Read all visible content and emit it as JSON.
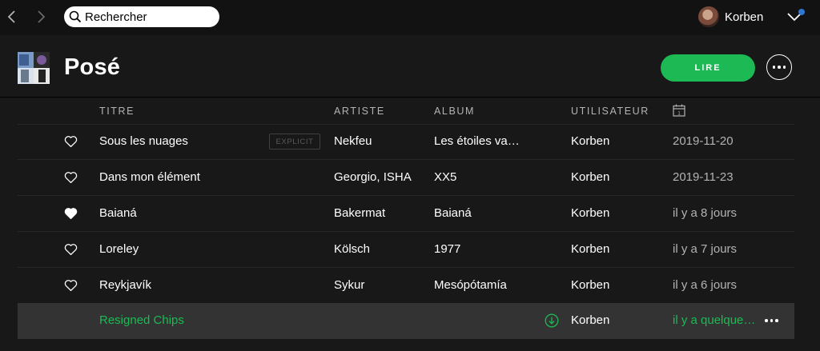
{
  "search": {
    "placeholder": "Rechercher"
  },
  "user": {
    "name": "Korben"
  },
  "playlist": {
    "title": "Posé",
    "play_label": "LIRE"
  },
  "columns": {
    "title": "TITRE",
    "artist": "ARTISTE",
    "album": "ALBUM",
    "user": "UTILISATEUR",
    "date_icon": "calendar-icon",
    "date_icon_day": "1"
  },
  "tracks": [
    {
      "title": "Sous les nuages",
      "explicit": "EXPLICIT",
      "artist": "Nekfeu",
      "album": "Les étoiles va…",
      "user": "Korben",
      "added": "2019-11-20",
      "liked": false
    },
    {
      "title": "Dans mon élément",
      "artist": "Georgio, ISHA",
      "album": "XX5",
      "user": "Korben",
      "added": "2019-11-23",
      "liked": false
    },
    {
      "title": "Baianá",
      "artist": "Bakermat",
      "album": "Baianá",
      "user": "Korben",
      "added": "il y a 8 jours",
      "liked": true
    },
    {
      "title": "Loreley",
      "artist": "Kölsch",
      "album": "1977",
      "user": "Korben",
      "added": "il y a 7 jours",
      "liked": false
    },
    {
      "title": "Reykjavík",
      "artist": "Sykur",
      "album": "Mesópótamía",
      "user": "Korben",
      "added": "il y a 6 jours",
      "liked": false
    },
    {
      "title": "Resigned Chips",
      "artist": "",
      "album": "",
      "user": "Korben",
      "added": "il y a quelque…",
      "selected": true
    }
  ],
  "colors": {
    "accent": "#1db954",
    "background": "#181818",
    "topbar": "#121212",
    "selected_row": "#333333",
    "notification": "#2e77d0"
  }
}
